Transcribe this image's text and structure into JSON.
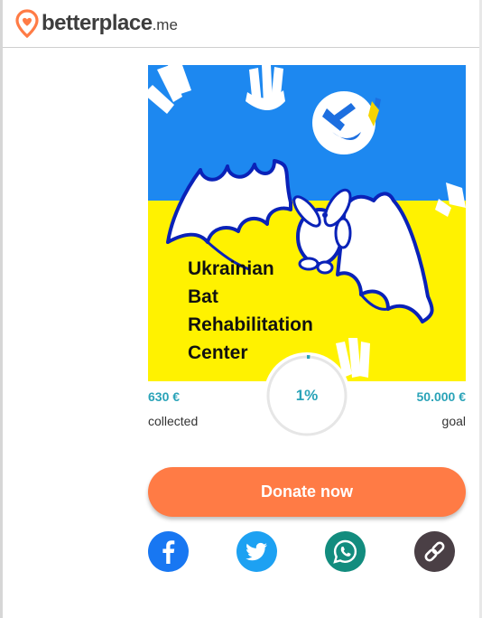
{
  "header": {
    "logo_name": "betterplace",
    "logo_tld": ".me"
  },
  "project": {
    "image_text_lines": [
      "Ukrainian",
      "Bat",
      "Rehabilitation",
      "Center"
    ],
    "progress_fraction": 0.0126
  },
  "stats": {
    "collected_amount": "630 €",
    "collected_label": "collected",
    "goal_amount": "50.000 €",
    "goal_label": "goal",
    "progress_text": "1%"
  },
  "donate": {
    "label": "Donate now"
  },
  "share": {
    "items": [
      "facebook-icon",
      "twitter-icon",
      "whatsapp-icon",
      "link-icon"
    ]
  },
  "colors": {
    "accent_teal": "#2aa3b8",
    "donate_orange": "#ff7b45",
    "flag_blue": "#1d88f0",
    "flag_yellow": "#fff200",
    "logo_pin": "#ff7b45"
  }
}
